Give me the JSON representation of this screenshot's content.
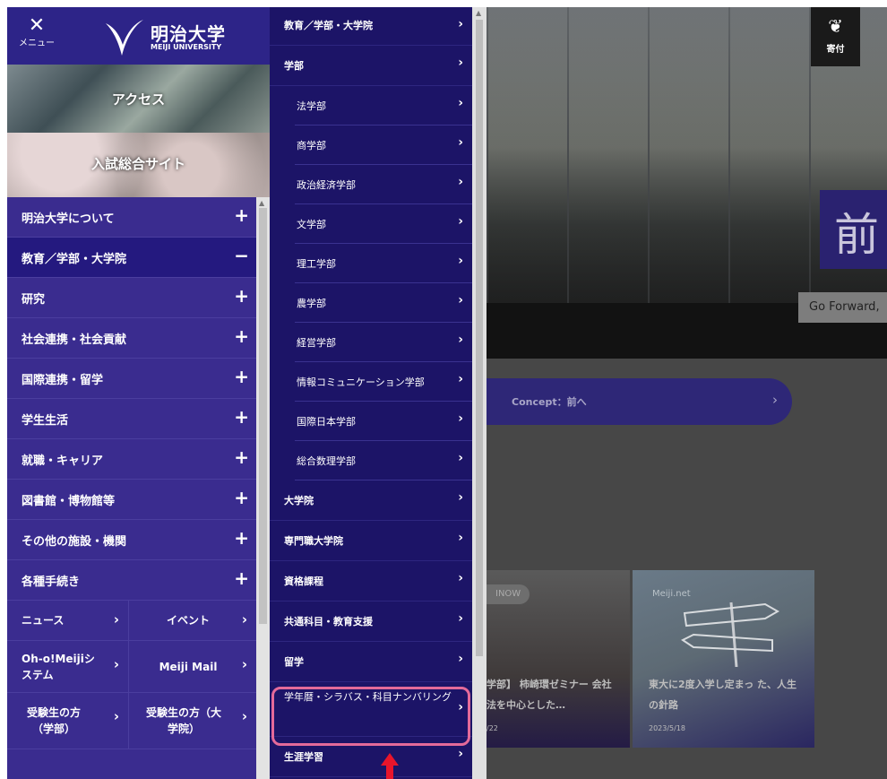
{
  "left": {
    "close_icon_glyph": "✕",
    "close_label": "メニュー",
    "logo_jp": "明治大学",
    "logo_en": "MEIJI UNIVERSITY",
    "access_label": "アクセス",
    "entrance_label": "入試総合サイト",
    "menu": [
      {
        "label": "明治大学について",
        "sign": "+"
      },
      {
        "label": "教育／学部・大学院",
        "sign": "−"
      },
      {
        "label": "研究",
        "sign": "+"
      },
      {
        "label": "社会連携・社会貢献",
        "sign": "+"
      },
      {
        "label": "国際連携・留学",
        "sign": "+"
      },
      {
        "label": "学生生活",
        "sign": "+"
      },
      {
        "label": "就職・キャリア",
        "sign": "+"
      },
      {
        "label": "図書館・博物館等",
        "sign": "+"
      },
      {
        "label": "その他の施設・機関",
        "sign": "+"
      },
      {
        "label": "各種手続き",
        "sign": "+"
      }
    ],
    "grid": {
      "news": "ニュース",
      "event": "イベント",
      "ohmeiji": "Oh-o!Meijiシステム",
      "mail": "Meiji Mail",
      "exam_ug": "受験生の方（学部）",
      "exam_g": "受験生の方（大学院）",
      "chevron": "›"
    }
  },
  "mid": {
    "chevron": "›",
    "top": [
      {
        "label": "教育／学部・大学院"
      },
      {
        "label": "学部"
      }
    ],
    "faculties": [
      {
        "label": "法学部"
      },
      {
        "label": "商学部"
      },
      {
        "label": "政治経済学部"
      },
      {
        "label": "文学部"
      },
      {
        "label": "理工学部"
      },
      {
        "label": "農学部"
      },
      {
        "label": "経営学部"
      },
      {
        "label": "情報コミュニケーション学部"
      },
      {
        "label": "国際日本学部"
      },
      {
        "label": "総合数理学部"
      }
    ],
    "more": [
      {
        "label": "大学院"
      },
      {
        "label": "専門職大学院"
      },
      {
        "label": "資格課程"
      },
      {
        "label": "共通科目・教育支援"
      },
      {
        "label": "留学"
      }
    ],
    "highlight_item": "学年暦・シラバス・科目ナンバリング",
    "last_item": "生涯学習"
  },
  "right": {
    "donate_icon": "❦",
    "donate_label": "寄付",
    "hero_char": "前",
    "hero_caption": "Go Forward,",
    "concept_label": "Concept：前へ",
    "concept_chevron": "›",
    "card1": {
      "tag": "INOW",
      "title": "学部】 柿崎環ゼミナー 会社法を中心とした…",
      "date": "/22"
    },
    "card2": {
      "tag": "Meiji.net",
      "title": "東大に2度入学し定まっ た、人生の針路",
      "date": "2023/5/18"
    }
  },
  "colors": {
    "menu_bg": "#3a2c8f",
    "submenu_bg": "#1c1467",
    "highlight_border": "#e46a9a",
    "arrow_red": "#e8152b"
  }
}
